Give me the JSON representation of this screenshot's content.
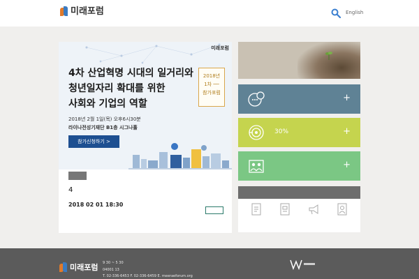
{
  "header": {
    "logo_text": "미래포럼",
    "nav": [
      "",
      "",
      "",
      ""
    ],
    "lang": "English"
  },
  "banner": {
    "logo_text": "미래포럼",
    "title_lines": [
      "4차 산업혁명 시대의 일거리와",
      "청년일자리 확대를 위한",
      "사회와 기업의 역할"
    ],
    "badge_lines": [
      "2018년",
      "1차 ──",
      "참가포럼"
    ],
    "date": "2018년 2월 1일(목) 오후6시30분",
    "place": "라이나전성기재단 B1층 시그나홀",
    "button_label": "참가신청하기 >"
  },
  "news": {
    "tag": "",
    "title": "4",
    "date": "2018 02 01 18:30",
    "more": "",
    "sub": ""
  },
  "photo_panel": {
    "small_text": "",
    "big_text": ""
  },
  "tiles": [
    {
      "label": "",
      "plus": "+",
      "icon": "speech-bubble-icon"
    },
    {
      "label": "30%",
      "plus": "+",
      "icon": "target-icon"
    },
    {
      "label": "",
      "plus": "+",
      "icon": "people-icon"
    }
  ],
  "quick": {
    "heading": "",
    "items": [
      {
        "label": "",
        "icon": "document-icon"
      },
      {
        "label": "",
        "icon": "report-icon"
      },
      {
        "label": "",
        "icon": "megaphone-icon"
      },
      {
        "label": "",
        "icon": "person-icon"
      }
    ]
  },
  "footer": {
    "logo_text": "미래포럼",
    "lines": [
      " 9 30 ~ 5 30",
      "04001 13",
      "T. 02-336-6453  F. 02-336-6459  E. meeraeforum.org"
    ],
    "partner": ""
  },
  "colors": {
    "banner_button": "#1d4f91",
    "tile_1": "#5f8295",
    "tile_2": "#c5d44e",
    "tile_3": "#7bc784",
    "footer_bg": "#5b5b5b",
    "search_icon": "#3a7fd0"
  }
}
